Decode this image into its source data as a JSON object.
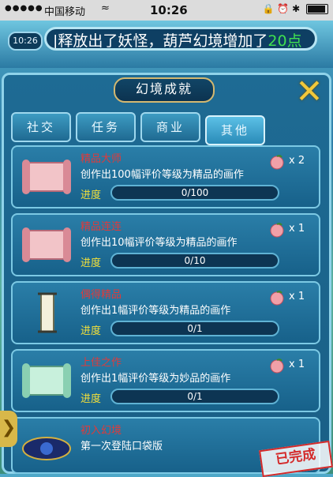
{
  "status_bar": {
    "signal": "●●●●●",
    "carrier": "中国移动",
    "wifi": "≈",
    "time": "10:26",
    "right_icons": "🔒 ⏰ ✱"
  },
  "topbar": {
    "time_badge": "10:26",
    "ticker_text": "|释放出了妖怪，葫芦幻境增加了",
    "ticker_highlight": "20点"
  },
  "panel": {
    "title": "幻境成就",
    "close_icon": "✕"
  },
  "tabs": [
    {
      "label": "社交"
    },
    {
      "label": "任务"
    },
    {
      "label": "商业"
    },
    {
      "label": "其他"
    }
  ],
  "progress_label": "进度",
  "achievements": [
    {
      "name": "精品大师",
      "desc": "创作出100幅评价等级为精品的画作",
      "progress_text": "0/100",
      "progress": 0,
      "reward": "x 2"
    },
    {
      "name": "精品连连",
      "desc": "创作出10幅评价等级为精品的画作",
      "progress_text": "0/10",
      "progress": 0,
      "reward": "x 1"
    },
    {
      "name": "偶得精品",
      "desc": "创作出1幅评价等级为精品的画作",
      "progress_text": "0/1",
      "progress": 0,
      "reward": "x 1"
    },
    {
      "name": "上佳之作",
      "desc": "创作出1幅评价等级为妙品的画作",
      "progress_text": "0/1",
      "progress": 0,
      "reward": "x 1"
    },
    {
      "name": "初入幻境",
      "desc": "第一次登陆口袋版"
    }
  ],
  "stamp": "已完成",
  "side_arrow": "❯"
}
